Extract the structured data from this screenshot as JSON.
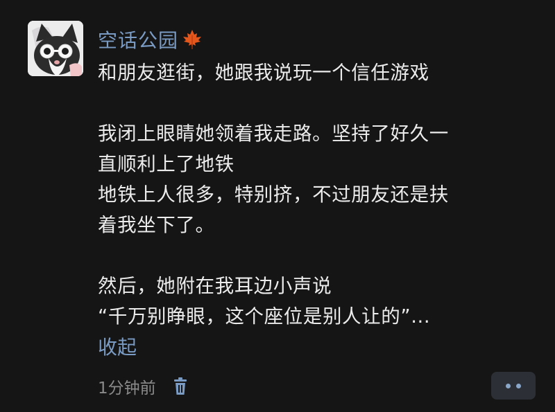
{
  "post": {
    "username": "空话公园",
    "username_icon": "maple-leaf-icon",
    "lines": [
      "和朋友逛街，她跟我说玩一个信任游戏",
      "",
      "我闭上眼睛她领着我走路。坚持了好久一",
      "直顺利上了地铁",
      "地铁上人很多，特别挤，不过朋友还是扶",
      "着我坐下了。",
      "",
      "然后，她附在我耳边小声说",
      "“千万别睁眼，这个座位是别人让的”..."
    ],
    "collapse_label": "收起",
    "time": "1分钟前",
    "delete_icon": "trash-icon",
    "more_icon": "more-dots-icon"
  },
  "colors": {
    "background": "#151515",
    "text": "#ececec",
    "link": "#7a9bc4",
    "meta": "#8a8a8a",
    "more_button_bg": "#2c2f35"
  }
}
